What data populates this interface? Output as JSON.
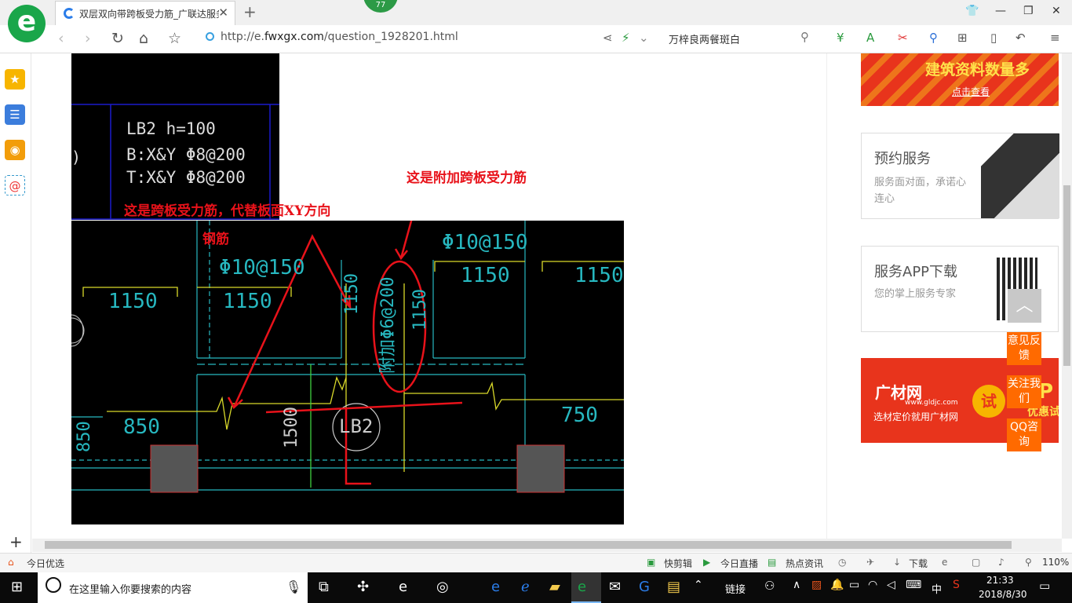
{
  "browser": {
    "tab_title": "双层双向带跨板受力筋_广联达服务",
    "badge": "77",
    "url_host": "http://e.",
    "url_domain": "fwxgx.com",
    "url_path": "/question_1928201.html",
    "search_value": "万梓良两餐斑白"
  },
  "sidebar": {
    "icons": [
      "star-icon",
      "feed-icon",
      "weibo-icon",
      "mail-icon"
    ],
    "add": "+"
  },
  "cad": {
    "top_block": {
      "line1": "LB2 h=100",
      "line2": "B:X&Y Φ8@200",
      "line3": "T:X&Y Φ8@200"
    },
    "rebar_labels": {
      "left": "Φ10@150",
      "right": "Φ10@150",
      "vertical_ellipse": "附加Φ6@200"
    },
    "dimensions": {
      "d1": "1150",
      "d2": "1150",
      "d3": "1150",
      "d4": "1150",
      "d5": "1150",
      "d6": "1150",
      "d7": "850",
      "d8": "850",
      "d9": "750",
      "d10": "1500"
    },
    "slab_tag": "LB2"
  },
  "annotations": {
    "right_note": "这是附加跨板受力筋",
    "left_note_line1": "这是跨板受力筋，代替板面XY方向",
    "left_note_line2": "钢筋"
  },
  "right_panel": {
    "banner_top": "建筑资料数量多",
    "banner_top_sub": "点击查看",
    "card1": {
      "title": "预约服务",
      "desc": "服务面对面，承诺心连心"
    },
    "card2": {
      "title": "服务APP下载",
      "desc": "您的掌上服务专家"
    },
    "banner_bottom": "广材网",
    "banner_bottom_url": "www.gldjc.com",
    "banner_bottom_slogan": "选材定价就用广材网",
    "banner_bottom_try": "试",
    "banner_bottom_tail": "P",
    "banner_bottom_tail2": "优惠试用"
  },
  "float_buttons": {
    "feedback": "意见反馈",
    "follow": "关注我们",
    "qq": "QQ咨询"
  },
  "statusbar": {
    "left": "今日优选",
    "kuaijianji": "快剪辑",
    "zhibo": "今日直播",
    "redian": "热点资讯",
    "xiazai": "下载",
    "zoom": "110%"
  },
  "taskbar": {
    "search_placeholder": "在这里输入你要搜索的内容",
    "lianjie": "链接",
    "ime": "中",
    "time": "21:33",
    "date": "2018/8/30"
  }
}
